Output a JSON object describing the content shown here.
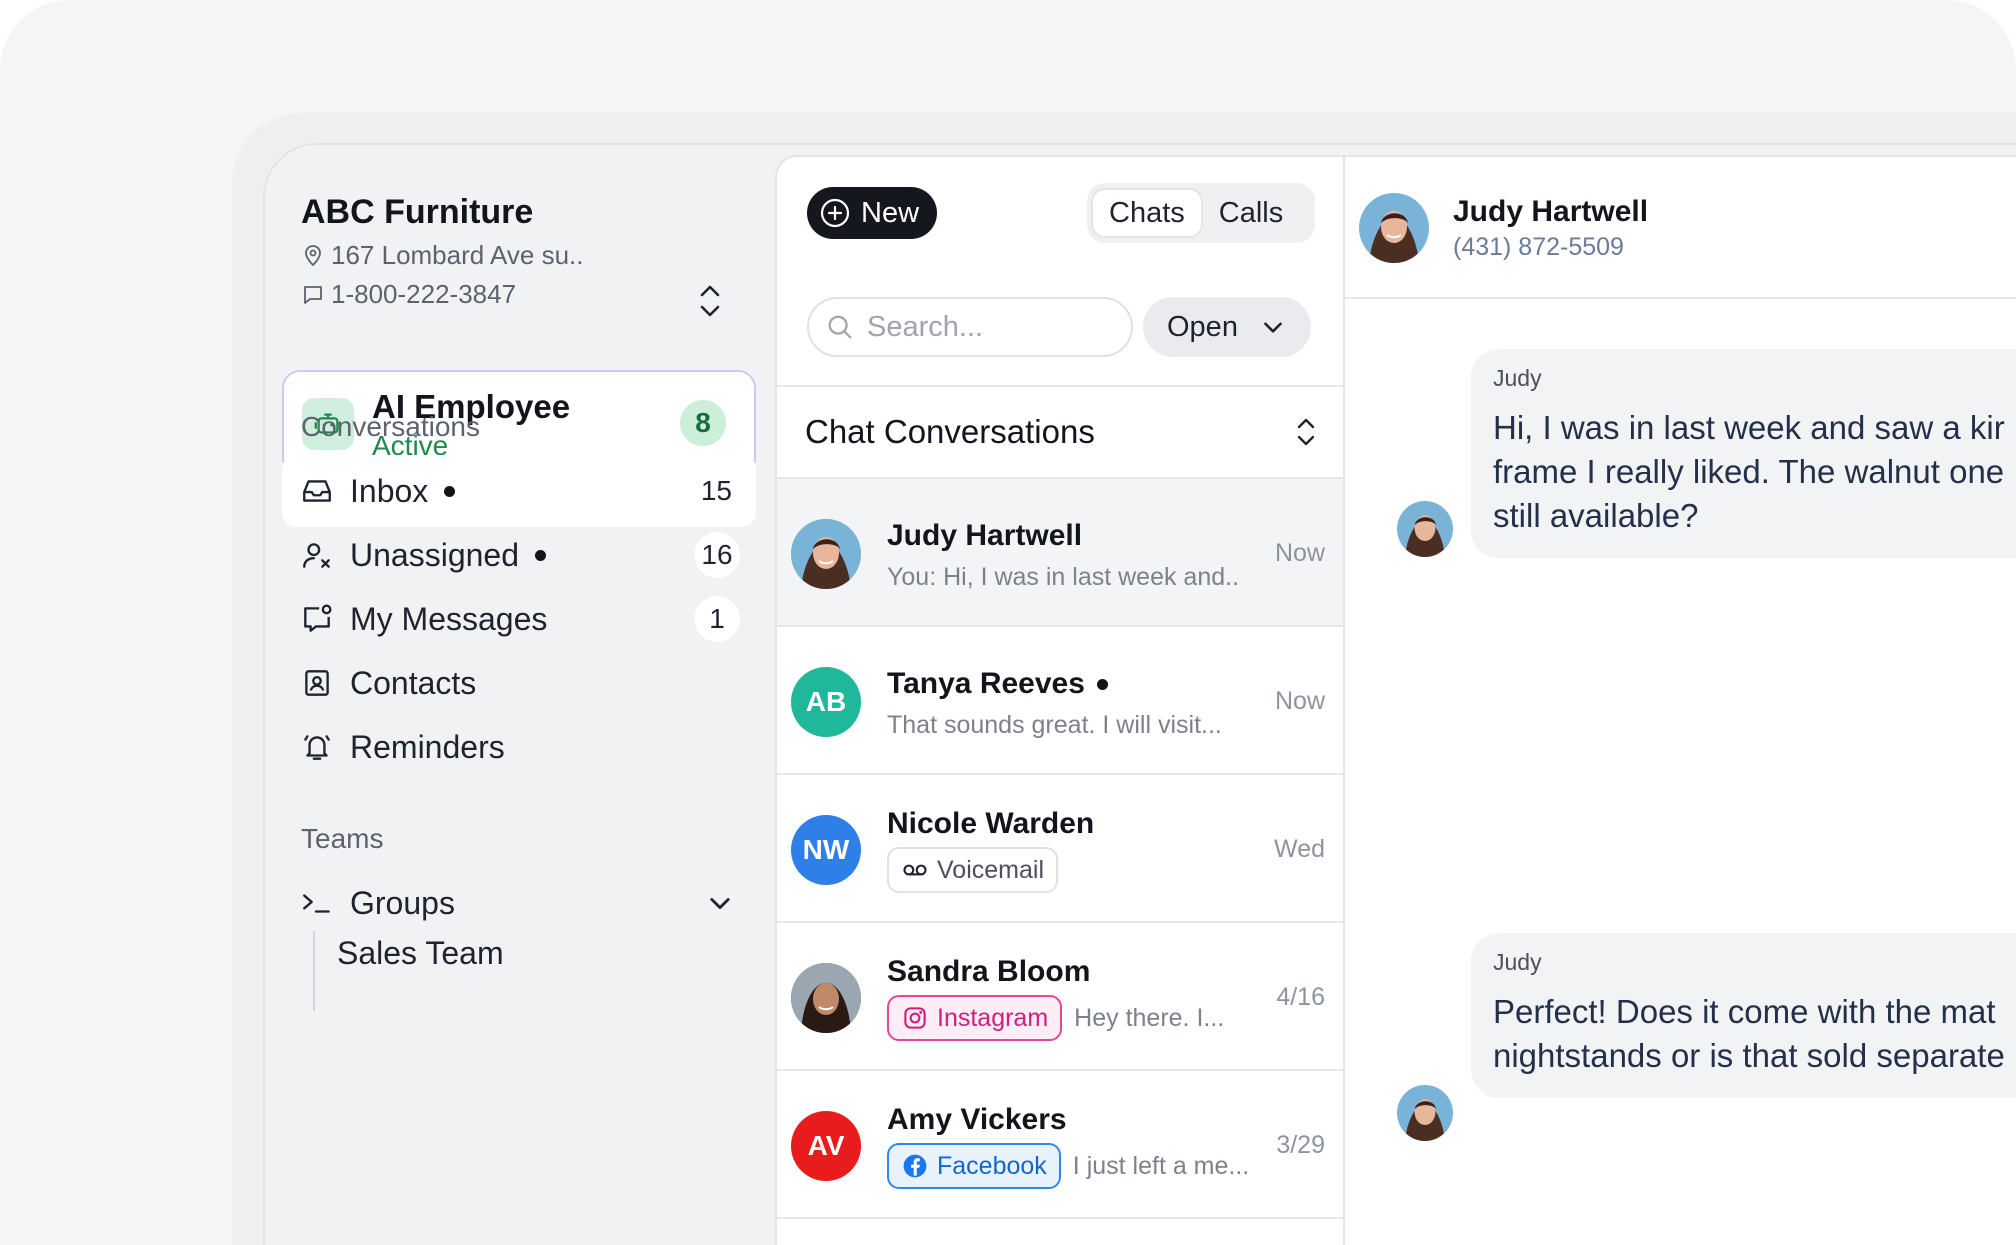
{
  "business": {
    "name": "ABC Furniture",
    "address": "167 Lombard Ave su..",
    "phone": "1-800-222-3847"
  },
  "ai_employee": {
    "title": "AI Employee",
    "status": "Active",
    "count": "8"
  },
  "sidebar": {
    "conversations_label": "Conversations",
    "items": [
      {
        "label": "Inbox",
        "count": "15",
        "icon": "inbox-icon",
        "unread_dot": true
      },
      {
        "label": "Unassigned",
        "count": "16",
        "icon": "user-x-icon",
        "unread_dot": true
      },
      {
        "label": "My Messages",
        "count": "1",
        "icon": "message-notify-icon",
        "unread_dot": false
      },
      {
        "label": "Contacts",
        "count": "",
        "icon": "contact-card-icon",
        "unread_dot": false
      },
      {
        "label": "Reminders",
        "count": "",
        "icon": "bell-ring-icon",
        "unread_dot": false
      }
    ],
    "teams_label": "Teams",
    "groups_label": "Groups",
    "group_items": [
      "Sales Team"
    ]
  },
  "list": {
    "new_label": "New",
    "tabs": [
      "Chats",
      "Calls"
    ],
    "active_tab": "Chats",
    "search_placeholder": "Search...",
    "filter_value": "Open",
    "header": "Chat Conversations",
    "conversations": [
      {
        "name": "Judy Hartwell",
        "preview": "You: Hi, I was in last week and..",
        "time": "Now",
        "avatar": "photo",
        "unread": false
      },
      {
        "name": "Tanya Reeves",
        "preview": "That sounds great. I will visit...",
        "time": "Now",
        "initials": "AB",
        "avatar_color": "#1fb89a",
        "unread": true
      },
      {
        "name": "Nicole Warden",
        "tag": "Voicemail",
        "time": "Wed",
        "initials": "NW",
        "avatar_color": "#2f7fe8",
        "unread": false
      },
      {
        "name": "Sandra Bloom",
        "tag": "Instagram",
        "preview": "Hey there. I...",
        "time": "4/16",
        "avatar": "photo",
        "unread": false
      },
      {
        "name": "Amy Vickers",
        "tag": "Facebook",
        "preview": "I just left a me...",
        "time": "3/29",
        "initials": "AV",
        "avatar_color": "#e81c1c",
        "unread": false
      }
    ]
  },
  "chat": {
    "contact_name": "Judy Hartwell",
    "contact_phone": "(431) 872-5509",
    "messages": [
      {
        "sender": "Judy",
        "lines": [
          "Hi, I was in last week and saw a kir",
          "frame I really liked. The walnut one",
          "still available?"
        ]
      },
      {
        "sender": "Judy",
        "lines": [
          "Perfect! Does it come with the mat",
          "nightstands or is that sold separate"
        ]
      }
    ]
  }
}
